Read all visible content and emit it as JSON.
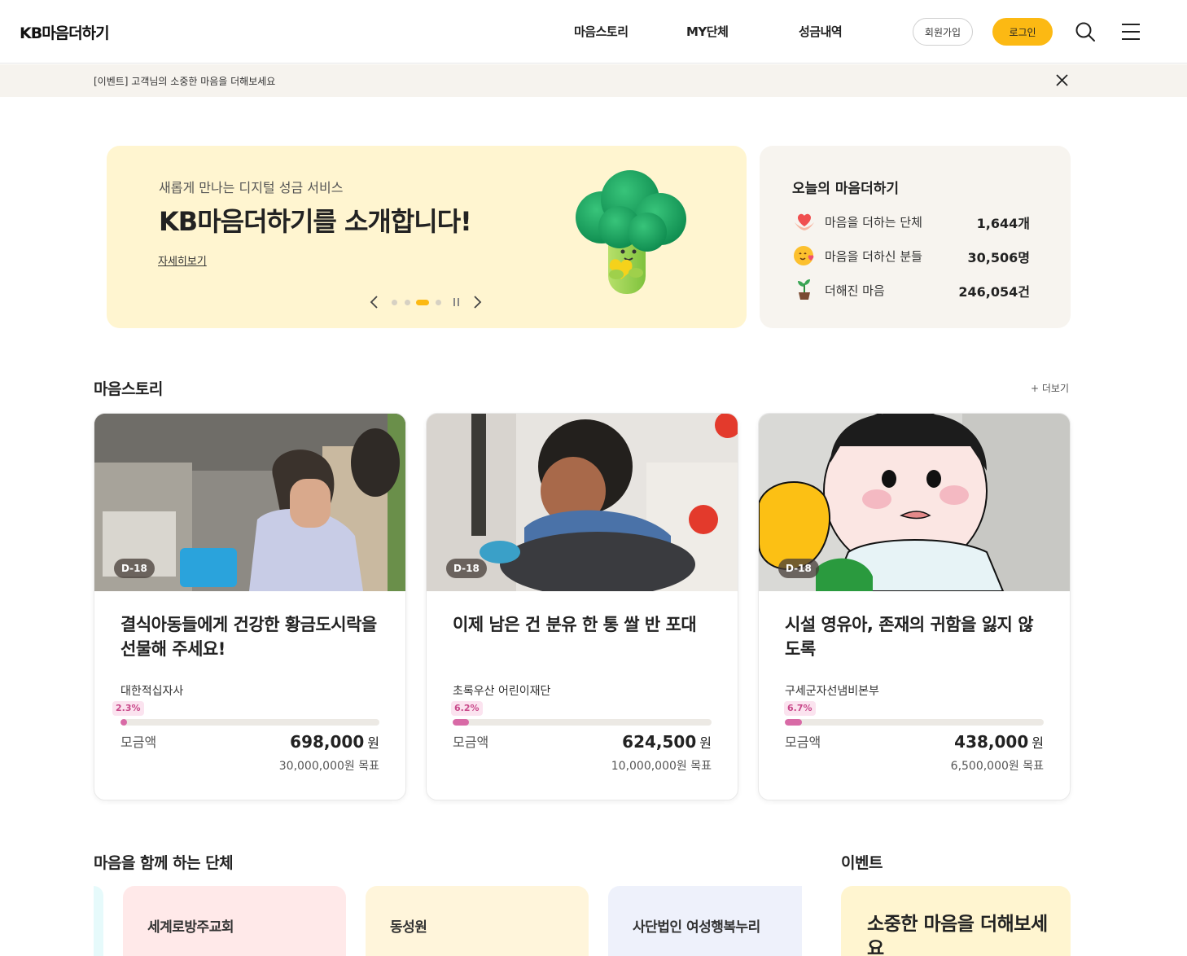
{
  "header": {
    "logo": "KB마음더하기",
    "nav": [
      "마음스토리",
      "MY단체",
      "성금내역"
    ],
    "join_label": "회원가입",
    "login_label": "로그인"
  },
  "notice": {
    "text": "[이벤트] 고객님의 소중한 마음을 더해보세요"
  },
  "hero": {
    "subtitle": "새롭게 만나는 디지털 성금 서비스",
    "title": "KB마음더하기를 소개합니다!",
    "link": "자세히보기",
    "slide_count": 5,
    "active_slide": 3
  },
  "today": {
    "title": "오늘의 마음더하기",
    "stats": [
      {
        "icon": "heart-hands-icon",
        "label": "마음을 더하는 단체",
        "value": "1,644개"
      },
      {
        "icon": "smile-heart-icon",
        "label": "마음을 더하신 분들",
        "value": "30,506명"
      },
      {
        "icon": "sprout-pot-icon",
        "label": "더해진 마음",
        "value": "246,054건"
      }
    ]
  },
  "stories": {
    "title": "마음스토리",
    "more": "+ 더보기",
    "raised_label": "모금액",
    "unit": "원",
    "cards": [
      {
        "dday": "D-18",
        "title": "결식아동들에게 건강한 황금도시락을 선물해 주세요!",
        "org": "대한적십자사",
        "percent": "2.3%",
        "progress": 0.023,
        "amount": "698,000",
        "goal": "30,000,000원 목표"
      },
      {
        "dday": "D-18",
        "title": "이제 남은 건 분유 한 통 쌀 반 포대",
        "org": "초록우산 어린이재단",
        "percent": "6.2%",
        "progress": 0.062,
        "amount": "624,500",
        "goal": "10,000,000원 목표"
      },
      {
        "dday": "D-18",
        "title": "시설 영유아, 존재의 귀함을 잃지 않도록",
        "org": "구세군자선냄비본부",
        "percent": "6.7%",
        "progress": 0.067,
        "amount": "438,000",
        "goal": "6,500,000원 목표"
      }
    ]
  },
  "orgs": {
    "title": "마음을 함께 하는 단체",
    "items": [
      {
        "name": "세계로방주교회",
        "color": "#ffe9e9"
      },
      {
        "name": "동성원",
        "color": "#fff5db"
      },
      {
        "name": "사단법인 여성행복누리",
        "color": "#eef1fb"
      }
    ]
  },
  "event": {
    "title": "이벤트",
    "card_title": "소중한 마음을 더해보세요"
  }
}
